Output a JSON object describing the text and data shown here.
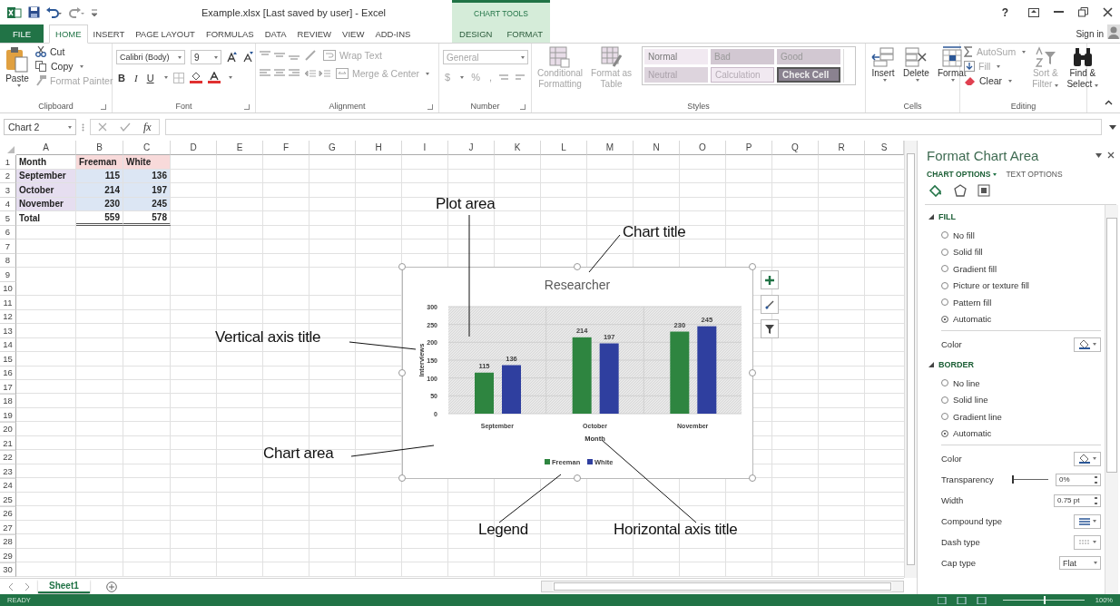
{
  "title_bar": {
    "title": "Example.xlsx [Last saved by user] - Excel",
    "contextual_group": "CHART TOOLS",
    "help": "?"
  },
  "tabs": [
    {
      "label": "FILE",
      "kind": "file",
      "selected": false
    },
    {
      "label": "HOME",
      "kind": "normal",
      "selected": true
    },
    {
      "label": "INSERT",
      "kind": "normal",
      "selected": false
    },
    {
      "label": "PAGE LAYOUT",
      "kind": "normal",
      "selected": false
    },
    {
      "label": "FORMULAS",
      "kind": "normal",
      "selected": false
    },
    {
      "label": "DATA",
      "kind": "normal",
      "selected": false
    },
    {
      "label": "REVIEW",
      "kind": "normal",
      "selected": false
    },
    {
      "label": "VIEW",
      "kind": "normal",
      "selected": false
    },
    {
      "label": "ADD-INS",
      "kind": "normal",
      "selected": false
    },
    {
      "label": "DESIGN",
      "kind": "contextual",
      "selected": false
    },
    {
      "label": "FORMAT",
      "kind": "contextual",
      "selected": false
    }
  ],
  "account": {
    "sign_in": "Sign in"
  },
  "ribbon": {
    "clipboard": {
      "label": "Clipboard",
      "paste": "Paste",
      "cut": {
        "label": "Cut",
        "disabled": false
      },
      "copy": {
        "label": "Copy",
        "disabled": false
      },
      "format_painter": {
        "label": "Format Painter",
        "disabled": true
      }
    },
    "font": {
      "label": "Font",
      "disabled": false,
      "name": "Calibri (Body)",
      "size": "9",
      "bold": "B",
      "italic": "I",
      "underline": "U"
    },
    "alignment": {
      "label": "Alignment",
      "disabled": true,
      "wrap_text": "Wrap Text",
      "merge_center": "Merge & Center"
    },
    "number": {
      "label": "Number",
      "disabled": true,
      "format": "General",
      "currency": "$",
      "percent": "%",
      "comma": ","
    },
    "styles": {
      "label": "Styles",
      "disabled": true,
      "conditional_formatting": [
        "Conditional",
        "Formatting"
      ],
      "format_as_table": [
        "Format as",
        "Table"
      ],
      "cell_styles": [
        {
          "label": "Normal",
          "kind": "normal"
        },
        {
          "label": "Bad",
          "kind": "bad"
        },
        {
          "label": "Good",
          "kind": "good"
        },
        {
          "label": "Neutral",
          "kind": "neutral"
        },
        {
          "label": "Calculation",
          "kind": "calculation"
        },
        {
          "label": "Check Cell",
          "kind": "check"
        }
      ]
    },
    "cells": {
      "label": "Cells",
      "disabled": false,
      "insert": "Insert",
      "delete": "Delete",
      "format": "Format"
    },
    "editing": {
      "label": "Editing",
      "autosum": {
        "label": "AutoSum",
        "disabled": true
      },
      "fill": {
        "label": "Fill",
        "disabled": true
      },
      "clear": {
        "label": "Clear",
        "disabled": false
      },
      "sort_filter": {
        "lines": [
          "Sort &",
          "Filter"
        ],
        "disabled": true
      },
      "find_select": {
        "lines": [
          "Find &",
          "Select"
        ],
        "disabled": false
      }
    }
  },
  "formula_bar": {
    "name_box": "Chart 2",
    "function": "fx"
  },
  "sheet": {
    "columns": [
      "A",
      "B",
      "C",
      "D",
      "E",
      "F",
      "G",
      "H",
      "I",
      "J",
      "K",
      "L",
      "M",
      "N",
      "O",
      "P",
      "Q",
      "R",
      "S"
    ],
    "row_numbers": [
      "1",
      "2",
      "3",
      "4",
      "5",
      "6",
      "7",
      "8",
      "9",
      "10",
      "11",
      "12",
      "13",
      "14",
      "15",
      "16",
      "17",
      "18",
      "19",
      "20",
      "21",
      "22",
      "23",
      "24",
      "25",
      "26",
      "27",
      "28",
      "29",
      "30"
    ],
    "rows": [
      {
        "kind": "header",
        "cells": [
          {
            "text": "Month"
          },
          {
            "text": "Freeman",
            "color": "#f8dada"
          },
          {
            "text": "White",
            "color": "#f8dada"
          }
        ]
      },
      {
        "kind": "data",
        "cells": [
          {
            "text": "September",
            "color": "#e6def0"
          },
          {
            "text": "115",
            "color": "#dce6f4"
          },
          {
            "text": "136",
            "color": "#dce6f4"
          }
        ]
      },
      {
        "kind": "data",
        "cells": [
          {
            "text": "October",
            "color": "#e6def0"
          },
          {
            "text": "214",
            "color": "#dce6f4"
          },
          {
            "text": "197",
            "color": "#dce6f4"
          }
        ]
      },
      {
        "kind": "data",
        "cells": [
          {
            "text": "November",
            "color": "#e6def0"
          },
          {
            "text": "230",
            "color": "#dce6f4"
          },
          {
            "text": "245",
            "color": "#dce6f4"
          }
        ]
      },
      {
        "kind": "total",
        "cells": [
          {
            "text": "Total"
          },
          {
            "text": "559"
          },
          {
            "text": "578"
          }
        ]
      }
    ]
  },
  "chart": {
    "chart_data": {
      "type": "bar",
      "title": "Researcher",
      "xlabel": "Month",
      "ylabel": "Interviews",
      "categories": [
        "September",
        "October",
        "November"
      ],
      "series": [
        {
          "name": "Freeman",
          "color": "#2e8540",
          "values": [
            115,
            214,
            230
          ]
        },
        {
          "name": "White",
          "color": "#2f3f9f",
          "values": [
            136,
            197,
            245
          ]
        }
      ],
      "ylim": [
        0,
        300
      ],
      "yticks": [
        0,
        50,
        100,
        150,
        200,
        250,
        300
      ],
      "data_labels": true,
      "grid": true,
      "legend": "bottom"
    }
  },
  "callouts": [
    {
      "text": "Plot area"
    },
    {
      "text": "Chart title"
    },
    {
      "text": "Vertical axis title"
    },
    {
      "text": "Chart area"
    },
    {
      "text": "Legend"
    },
    {
      "text": "Horizontal axis title"
    }
  ],
  "sheet_tabs": [
    {
      "label": "Sheet1",
      "selected": true
    }
  ],
  "format_pane": {
    "title": "Format Chart Area",
    "tabs": [
      {
        "label": "CHART OPTIONS",
        "selected": true
      },
      {
        "label": "TEXT OPTIONS",
        "selected": false
      }
    ],
    "icon_tabs": [
      {
        "selected": true
      },
      {
        "selected": false
      },
      {
        "selected": false
      }
    ],
    "sections": [
      {
        "title": "FILL",
        "expanded": true,
        "options": [
          {
            "label": "No fill",
            "selected": false
          },
          {
            "label": "Solid fill",
            "selected": false
          },
          {
            "label": "Gradient fill",
            "selected": false
          },
          {
            "label": "Picture or texture fill",
            "selected": false
          },
          {
            "label": "Pattern fill",
            "selected": false
          },
          {
            "label": "Automatic",
            "selected": true
          }
        ],
        "properties": [
          {
            "label": "Color",
            "kind": "color"
          }
        ]
      },
      {
        "title": "BORDER",
        "expanded": true,
        "options": [
          {
            "label": "No line",
            "selected": false
          },
          {
            "label": "Solid line",
            "selected": false
          },
          {
            "label": "Gradient line",
            "selected": false
          },
          {
            "label": "Automatic",
            "selected": true
          }
        ],
        "properties": [
          {
            "label": "Color",
            "kind": "color"
          },
          {
            "label": "Transparency",
            "kind": "slider",
            "level": 0,
            "value": "0%"
          },
          {
            "label": "Width",
            "kind": "spin",
            "value": "0.75 pt"
          },
          {
            "label": "Compound type",
            "kind": "compound"
          },
          {
            "label": "Dash type",
            "kind": "dash"
          },
          {
            "label": "Cap type",
            "kind": "select",
            "value": "Flat"
          }
        ]
      }
    ]
  },
  "status_bar": {
    "mode": "READY",
    "zoom": "100%",
    "zoom_slider": {
      "level": 0.5
    }
  }
}
